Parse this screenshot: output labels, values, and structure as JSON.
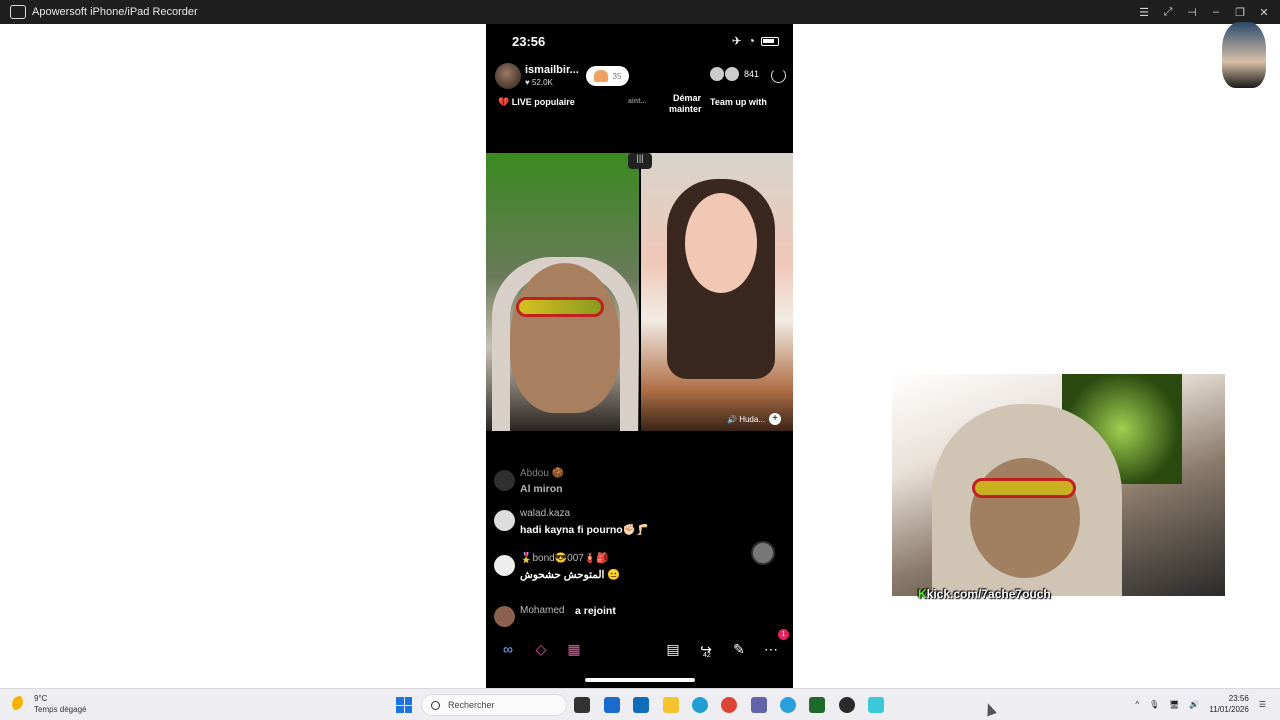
{
  "window": {
    "title": "Apowersoft iPhone/iPad Recorder",
    "controls": [
      "list-icon",
      "expand-icon",
      "pin-icon",
      "minimize-icon",
      "restore-icon",
      "close-icon"
    ]
  },
  "phone": {
    "status": {
      "time": "23:56"
    },
    "host": {
      "name": "ismailbir...",
      "likes": "♥ 52.0K",
      "follow_count": "35"
    },
    "viewers": {
      "count": "841"
    },
    "banners": {
      "live_popular": "💔 LIVE populaire",
      "faded": "aint...",
      "start_now_line1": "Démar",
      "start_now_line2": "mainter",
      "team_up": "Team up with"
    },
    "split_handle": "|||",
    "guest": {
      "label": "🔊 Huda..."
    },
    "comments": [
      {
        "user": "Abdou 🍪",
        "text": "Al miron"
      },
      {
        "user": "walad.kaza",
        "text": "hadi kayna fi pourno✊🏻🦵🏻"
      },
      {
        "user": "🎖️bond😎007🧯🎒",
        "text": "المتوحش حشحوش 😐"
      },
      {
        "user": "Mohamed",
        "text": "a rejoint"
      }
    ],
    "bottom_icons": [
      "multi-guest-icon",
      "link-icon",
      "apps-icon",
      "clip-icon",
      "share-icon",
      "edit-icon",
      "more-icon"
    ],
    "share_count": "42",
    "more_badge": "1"
  },
  "overlay": {
    "kick_prefix": "K",
    "kick_url": "kick.com/7ache7ouch"
  },
  "taskbar": {
    "weather_temp": "9°C",
    "weather_desc": "Temps dégagé",
    "search_placeholder": "Rechercher",
    "clock_time": "23:56",
    "clock_date": "11/01/2026"
  },
  "colors": {
    "kick_green": "#53fc18",
    "badge_pink": "#e0245e",
    "windows_blue": "#1b74e4"
  }
}
